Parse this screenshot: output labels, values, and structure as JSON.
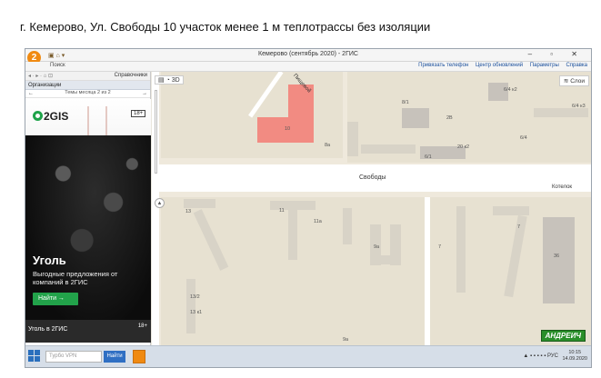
{
  "caption": "г. Кемерово, Ул. Свободы 10 участок менее 1 м теплотрассы без изоляции",
  "window": {
    "title": "Кемерово (сентябрь 2020) - 2ГИС",
    "search_tab": "Поиск",
    "controls": "– ▫ ✕"
  },
  "toolbar": {
    "bind_phone": "Привязать телефон",
    "updates": "Центр обновлений",
    "params": "Параметры",
    "help": "Справка"
  },
  "panel": {
    "references": "Справочники",
    "organizations": "Организации",
    "topics": "Темы месяца 2 из 2"
  },
  "ad": {
    "logo": "2GIS",
    "age": "18+",
    "title": "Уголь",
    "subtitle": "Выгодные предложения от компаний в 2ГИС",
    "button": "Найти →",
    "footer": "Уголь в 2ГИС",
    "footer_age": "18+"
  },
  "map": {
    "mode_3d": "3D",
    "layers": "Слои",
    "street_main": "Свободы",
    "street_diag": "Пищевой",
    "street_right": "Котелок",
    "watermark": "АНДРЕИЧ",
    "highlight_color": "#f28b82",
    "buildings": {
      "b1": "6/4 к2",
      "b2": "8/1",
      "b3": "2В",
      "b4": "20 к2",
      "b5": "6/4 к3",
      "b6": "6/4",
      "b7": "6/1",
      "b8": "8а",
      "b9": "10",
      "b10": "13",
      "b11": "11",
      "b12": "11а",
      "b13": "9а",
      "b14": "7",
      "b15": "7",
      "b16": "36",
      "b17": "13/2",
      "b18": "13 к1",
      "b19": "9а"
    }
  },
  "taskbar": {
    "search_placeholder": "Турбо VPN",
    "find": "Найти",
    "lang": "РУС",
    "time": "10:15",
    "date": "14.09.2020"
  }
}
